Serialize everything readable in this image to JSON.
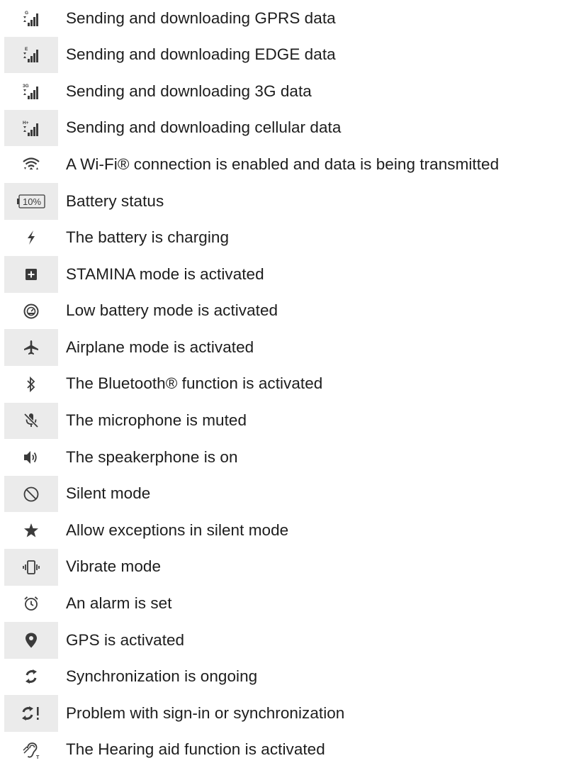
{
  "colors": {
    "icon": "#3b3b3b",
    "text": "#1d1d1d",
    "stripe": "#ebebeb"
  },
  "rows": [
    {
      "icon": "signal-gprs-icon",
      "badge": "G",
      "label": "Sending and downloading GPRS data"
    },
    {
      "icon": "signal-edge-icon",
      "badge": "E",
      "label": "Sending and downloading EDGE data"
    },
    {
      "icon": "signal-3g-icon",
      "badge": "3G",
      "label": "Sending and downloading 3G data"
    },
    {
      "icon": "signal-hplus-icon",
      "badge": "H+",
      "label": "Sending and downloading cellular data"
    },
    {
      "icon": "wifi-icon",
      "label": "A Wi-Fi® connection is enabled and data is being transmitted"
    },
    {
      "icon": "battery-icon",
      "badge": "10%",
      "label": "Battery status"
    },
    {
      "icon": "charging-bolt-icon",
      "label": "The battery is charging"
    },
    {
      "icon": "stamina-icon",
      "label": "STAMINA mode is activated"
    },
    {
      "icon": "low-battery-mode-icon",
      "label": "Low battery mode is activated"
    },
    {
      "icon": "airplane-icon",
      "label": "Airplane mode is activated"
    },
    {
      "icon": "bluetooth-icon",
      "label": "The Bluetooth® function is activated"
    },
    {
      "icon": "mic-muted-icon",
      "label": "The microphone is muted"
    },
    {
      "icon": "speakerphone-icon",
      "label": "The speakerphone is on"
    },
    {
      "icon": "silent-mode-icon",
      "label": "Silent mode"
    },
    {
      "icon": "star-icon",
      "label": "Allow exceptions in silent mode"
    },
    {
      "icon": "vibrate-icon",
      "label": "Vibrate mode"
    },
    {
      "icon": "alarm-icon",
      "label": "An alarm is set"
    },
    {
      "icon": "gps-pin-icon",
      "label": "GPS is activated"
    },
    {
      "icon": "sync-icon",
      "label": "Synchronization is ongoing"
    },
    {
      "icon": "sync-problem-icon",
      "label": "Problem with sign-in or synchronization"
    },
    {
      "icon": "hearing-aid-icon",
      "label": "The Hearing aid function is activated"
    }
  ]
}
